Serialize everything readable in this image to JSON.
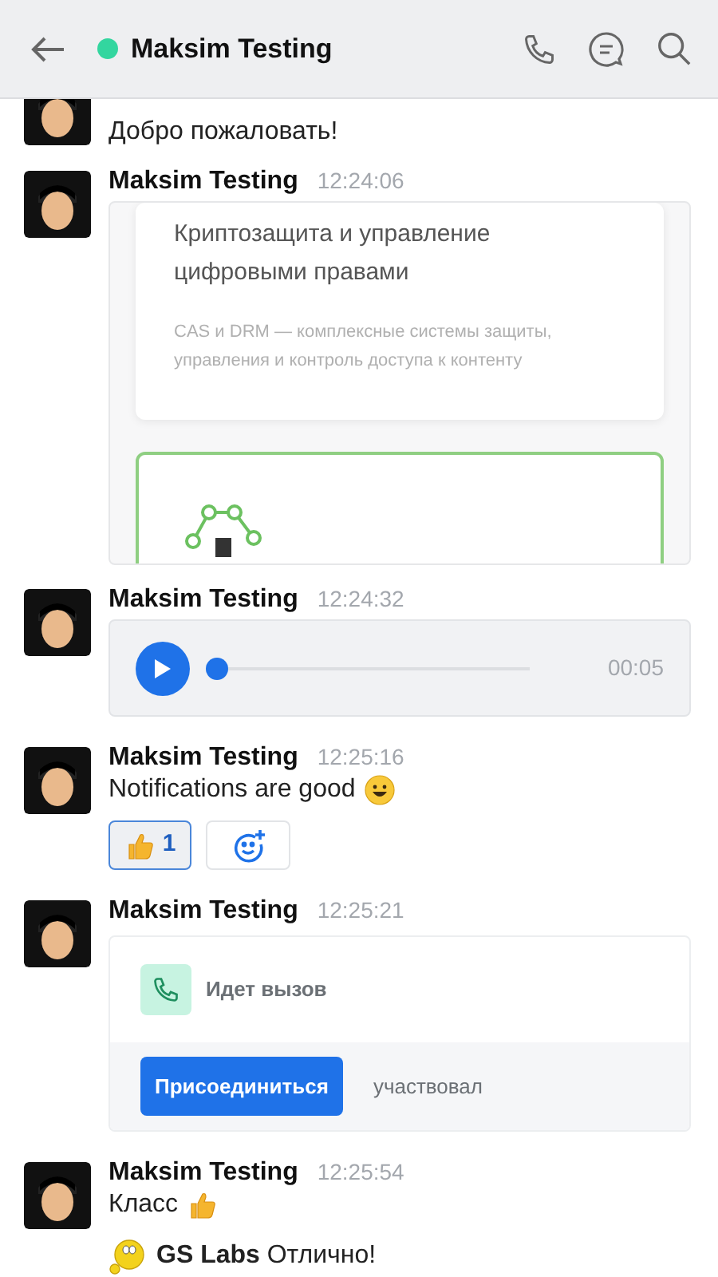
{
  "header": {
    "title": "Maksim Testing",
    "online": true
  },
  "messages": [
    {
      "kind": "clipped",
      "text": "Добро пожаловать!"
    },
    {
      "kind": "preview",
      "author": "Maksim Testing",
      "time": "12:24:06",
      "title": "Криптозащита и управление цифровыми правами",
      "description": "CAS и DRM — комплексные системы защиты, управления и контроль доступа к контенту"
    },
    {
      "kind": "audio",
      "author": "Maksim Testing",
      "time": "12:24:32",
      "level": 0,
      "duration": "00:05"
    },
    {
      "kind": "text",
      "author": "Maksim Testing",
      "time": "12:25:16",
      "text": "Notifications are good",
      "emoji": {
        "kind": "smile"
      },
      "reactions": [
        {
          "count": "1",
          "selected": true
        }
      ]
    },
    {
      "kind": "call",
      "author": "Maksim Testing",
      "time": "12:25:21",
      "status": "Идет вызов",
      "button": "Присоединиться",
      "note": "участвовал"
    },
    {
      "kind": "text",
      "author": "Maksim Testing",
      "time": "12:25:54",
      "text": "Класс",
      "emoji": {
        "kind": "thumb"
      },
      "signature": "**GS Labs** Отлично!"
    }
  ]
}
